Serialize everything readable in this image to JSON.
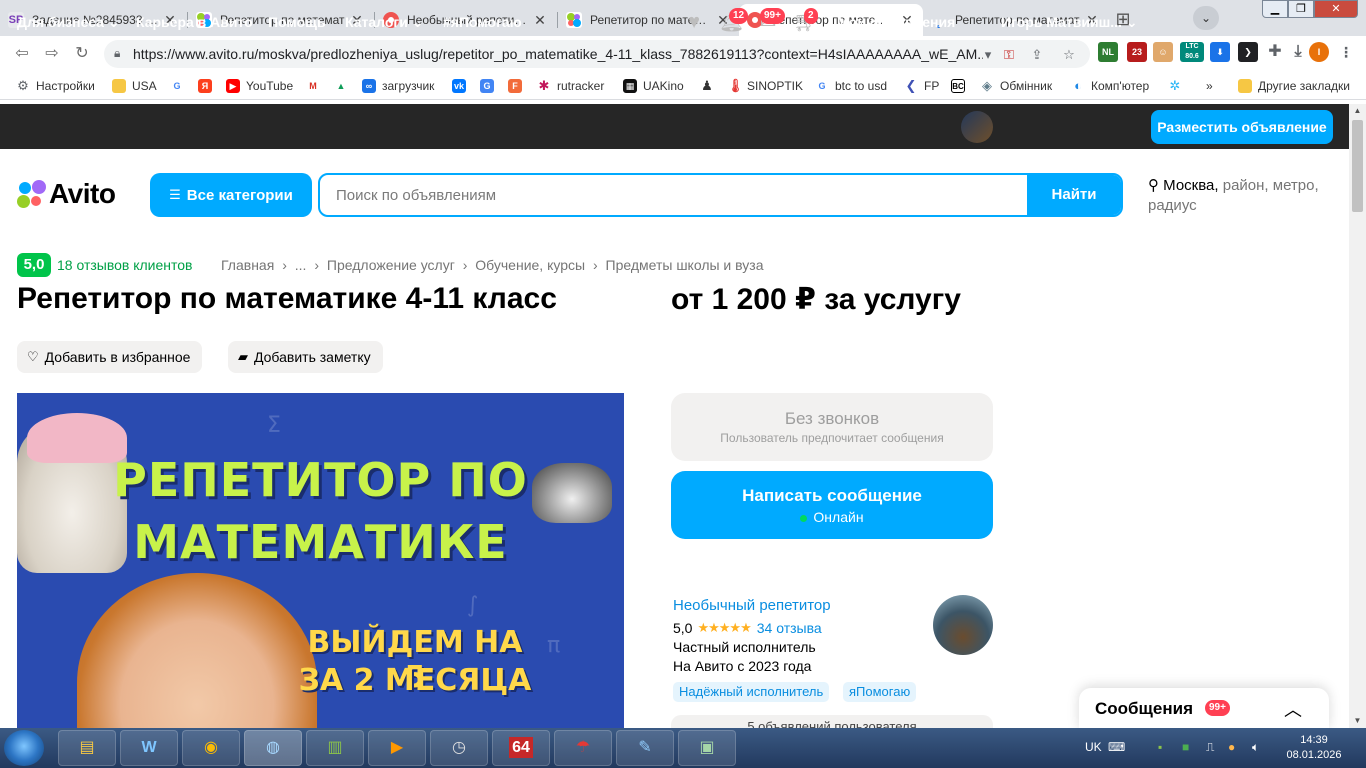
{
  "browser": {
    "tabs": [
      {
        "title": "Задание №2845938 - п",
        "fav_text": "SP",
        "fav_color": "#e8eaed",
        "fav_fg": "#7a3fb8"
      },
      {
        "title": "Репетитор по математ",
        "fav_text": "●",
        "fav_color": "#ffffff",
        "fav_fg": "#2fa3e6"
      },
      {
        "title": "Необычный репетитор",
        "fav_text": "●",
        "fav_color": "#ef5350",
        "fav_fg": "#ffffff"
      },
      {
        "title": "Репетитор по математ",
        "fav_text": "●",
        "fav_color": "#ffffff",
        "fav_fg": "#2fa3e6"
      },
      {
        "title": "Репетитор по математ",
        "fav_text": "●",
        "fav_color": "#ef5350",
        "fav_fg": "#ffffff"
      },
      {
        "title": "Репетитор по математ",
        "fav_text": "˛",
        "fav_color": "#ffffff",
        "fav_fg": "#1a73e8"
      }
    ],
    "url": "https://www.avito.ru/moskva/predlozheniya_uslug/repetitor_po_matematike_4-11_klass_7882619113?context=H4sIAAAAAAAA_wE_AM...",
    "ext_labels": [
      "NL",
      "23",
      "LTC 80.6"
    ],
    "bookmarks": [
      "Настройки",
      "USA",
      "",
      "",
      "YouTube",
      "",
      "",
      "загрузчик",
      "",
      "",
      "",
      "rutracker",
      "UAKino",
      "",
      "SINOPTIK",
      "btc to usd",
      "FP",
      "",
      "Обмінник",
      "Комп'ютер",
      "",
      "»",
      "Другие закладки"
    ]
  },
  "avito": {
    "nav": [
      "Для бизнеса",
      "Карьера в Авито",
      "Помощь",
      "Каталоги",
      "#яПомогаю"
    ],
    "badges": {
      "notifications": "12",
      "messages": "99+",
      "cart": "2"
    },
    "my_ads": "Мои объявления",
    "user_name": "Игорь Матвииш...",
    "post_button": "Разместить объявление",
    "logo": "Avito",
    "all_categories": "Все категории",
    "search_placeholder": "Поиск по объявлениям",
    "search_button": "Найти",
    "location_main": "Москва,",
    "location_rest": "район, метро, радиус"
  },
  "listing": {
    "rating": "5,0",
    "reviews": "18 отзывов клиентов",
    "breadcrumbs": [
      "Главная",
      "›",
      "...",
      "›",
      "Предложение услуг",
      "›",
      "Обучение, курсы",
      "›",
      "Предметы школы и вуза"
    ],
    "title": "Репетитор по математике 4-11 класс",
    "price": "от 1 200 ₽ за услугу",
    "add_favorite": "Добавить в избранное",
    "add_note": "Добавить заметку",
    "photo": {
      "headline_1": "РЕПЕТИТОР ПО",
      "headline_2": "МАТЕМАТИКЕ",
      "promo_1": "ВЫЙДЕМ НА 5",
      "promo_2": "ЗА 2 МЕСЯЦА"
    }
  },
  "contact": {
    "no_calls_title": "Без звонков",
    "no_calls_sub": "Пользователь предпочитает сообщения",
    "write_title": "Написать сообщение",
    "write_status": "Онлайн"
  },
  "seller": {
    "name": "Необычный репетитор",
    "rating": "5,0",
    "stars": "★★★★★",
    "reviews": "34 отзыва",
    "type": "Частный исполнитель",
    "since": "На Авито с 2023 года",
    "tags": [
      "Надёжный исполнитель",
      "яПомогаю"
    ],
    "more": "5 объявлений пользователя"
  },
  "messages_panel": {
    "label": "Сообщения",
    "badge": "99+"
  },
  "taskbar": {
    "lang": "UK",
    "time": "14:39",
    "date": "08.01.2026",
    "app_64": "64"
  },
  "colors": {
    "accent": "#00aaff",
    "success": "#00c44a",
    "badge": "#ff4053",
    "header": "#262626"
  }
}
